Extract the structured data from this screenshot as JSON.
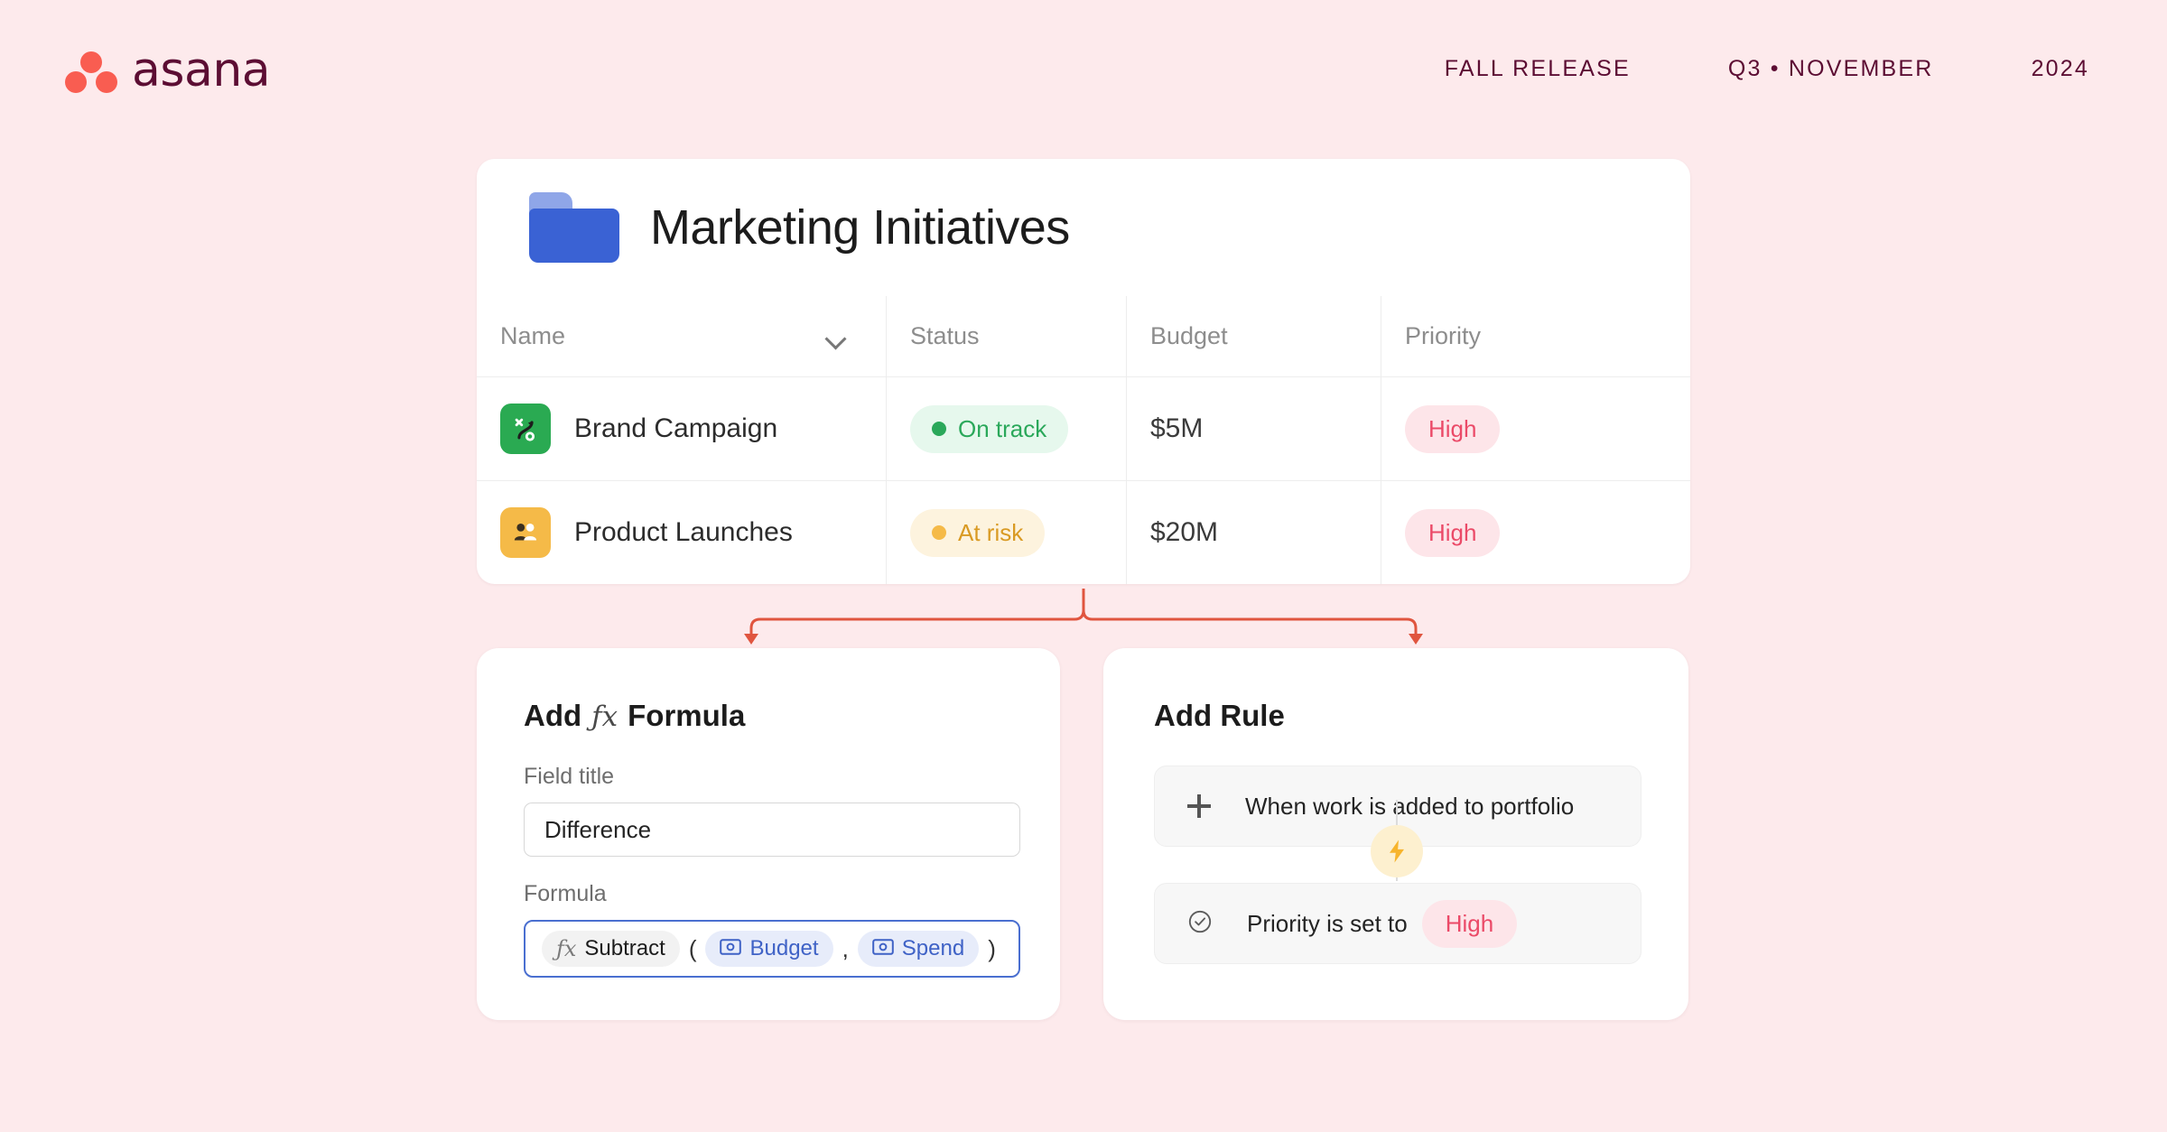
{
  "brand": {
    "logo_name": "asana",
    "logo_dot_color": "#f95d51",
    "wordmark_color": "#5c0d33"
  },
  "header": {
    "items": [
      {
        "label": "FALL RELEASE"
      },
      {
        "label": "Q3 • NOVEMBER"
      },
      {
        "label": "2024"
      }
    ]
  },
  "portfolio": {
    "title": "Marketing Initiatives",
    "folder_icon_color": "#3a62d4",
    "columns": [
      {
        "label": "Name"
      },
      {
        "label": "Status"
      },
      {
        "label": "Budget"
      },
      {
        "label": "Priority"
      }
    ],
    "rows": [
      {
        "icon": "strategy-icon",
        "icon_color": "#2aaa52",
        "name": "Brand Campaign",
        "status": "On track",
        "status_color": "#2aa85a",
        "budget": "$5M",
        "priority": "High",
        "priority_color": "#eb4a68"
      },
      {
        "icon": "people-icon",
        "icon_color": "#f5ba48",
        "name": "Product Launches",
        "status": "At risk",
        "status_color": "#d99a23",
        "budget": "$20M",
        "priority": "High",
        "priority_color": "#eb4a68"
      }
    ]
  },
  "connector": {
    "color": "#e0553f"
  },
  "formula_card": {
    "title_prefix": "Add",
    "title_fx": "ƒx",
    "title_suffix": "Formula",
    "field_title_label": "Field title",
    "field_title_value": "Difference",
    "field_title_placeholder": "Field title",
    "formula_label": "Formula",
    "formula_tokens": {
      "function_fx": "ƒx",
      "function_name": "Subtract",
      "open_paren": "(",
      "arg1": "Budget",
      "comma": ",",
      "arg2": "Spend",
      "close_paren": ")"
    },
    "focus_border_color": "#4a6fd0",
    "field_token_color": "#3f62c6"
  },
  "rule_card": {
    "title": "Add Rule",
    "trigger": {
      "icon": "plus-icon",
      "label": "When work is added to portfolio"
    },
    "bolt_icon": "lightning-bolt-icon",
    "action": {
      "icon": "check-circle-icon",
      "label": "Priority is set to",
      "value": "High",
      "value_color": "#eb4a68"
    }
  }
}
